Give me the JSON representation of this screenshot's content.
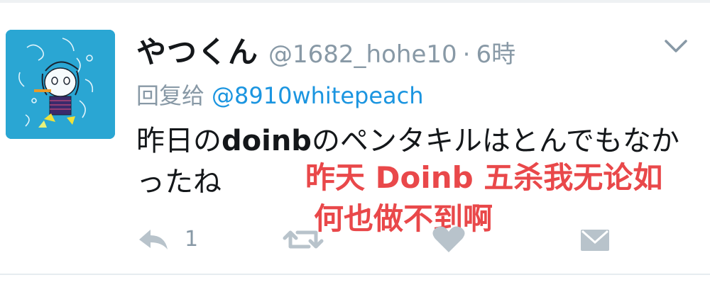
{
  "tweet": {
    "display_name": "やつくん",
    "handle": "@1682_hohe10",
    "separator": "·",
    "time": "6時",
    "reply_prefix": "回复给",
    "reply_target": "@8910whitepeach",
    "body_part1": "昨日の",
    "body_bold": "doinb",
    "body_part2": "のペンタキルはとんでもなかったね",
    "reply_count": "1"
  },
  "overlay": {
    "line1": "昨天 Doinb 五杀我无论如",
    "line2": "何也做不到啊"
  },
  "icons": {
    "more": "chevron-down-icon",
    "reply": "reply-arrow-icon",
    "retweet": "retweet-icon",
    "like": "heart-icon",
    "dm": "envelope-icon"
  },
  "colors": {
    "avatar_bg": "#2aa6d3",
    "text": "#14171a",
    "muted": "#8899a6",
    "link": "#1b95e0",
    "overlay": "#e9484a"
  }
}
